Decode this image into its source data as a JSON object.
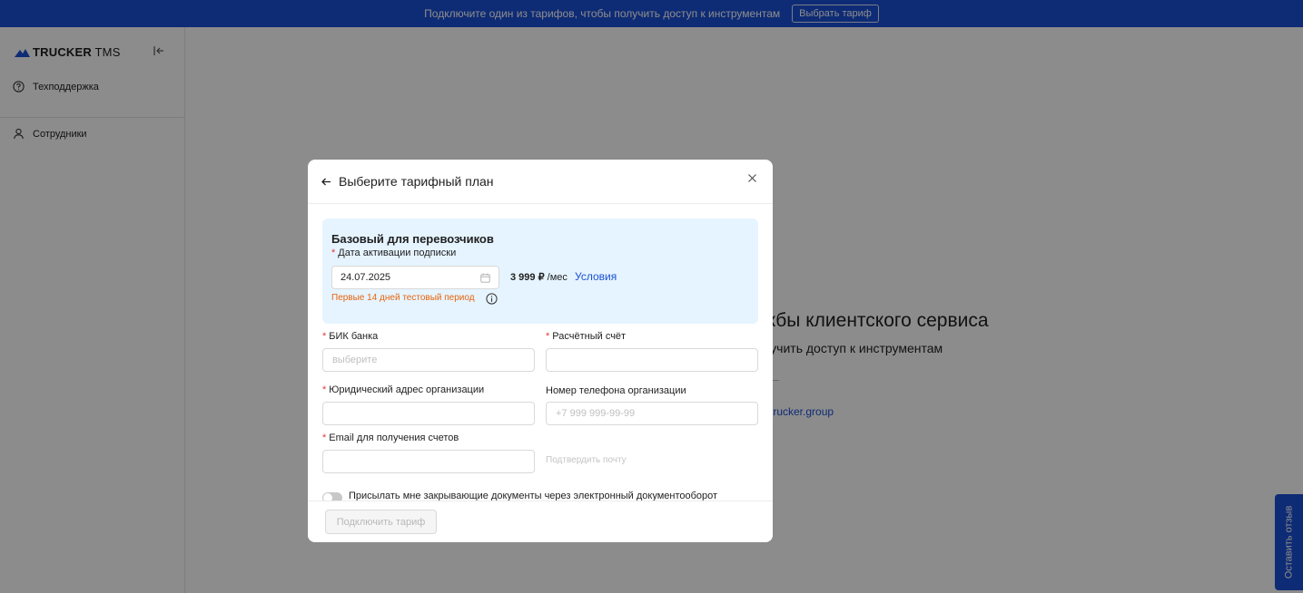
{
  "banner": {
    "text": "Подключите один из тарифов, чтобы получить доступ к инструментам",
    "button_label": "Выбрать тариф",
    "color": "#1a4fd6"
  },
  "sidebar": {
    "logo_bold": "TRUCKER",
    "logo_light": " TMS",
    "items": [
      {
        "label": "Техподдержка",
        "icon": "help-circle-icon"
      },
      {
        "label": "Сотрудники",
        "icon": "user-icon"
      }
    ]
  },
  "background": {
    "title_fragment": "жбы клиентского сервиса",
    "subtitle_fragment": "лучить доступ к инструментам",
    "link_fragment": "trucker.group"
  },
  "feedback": {
    "label": "Оставить отзыв"
  },
  "modal": {
    "title": "Выберите тарифный план",
    "plan": {
      "name": "Базовый для перевозчиков",
      "date_label": "Дата активации подписки",
      "date_value": "24.07.2025",
      "price": "3 999 ₽",
      "price_unit": " /мес",
      "terms_link": "Условия",
      "trial_note": "Первые 14 дней тестовый период"
    },
    "fields": {
      "bik_label": "БИК банка",
      "bik_placeholder": "выберите",
      "account_label": "Расчётный счёт",
      "account_value": "",
      "address_label": "Юридический адрес организации",
      "address_value": "",
      "phone_label": "Номер телефона организации",
      "phone_placeholder": "+7 999 999-99-99",
      "email_label": "Email для получения счетов",
      "email_value": "",
      "confirm_email": "Подтвердить почту"
    },
    "edo_toggle_label": "Присылать мне закрывающие документы через электронный документооборот",
    "edo_toggle_on": false,
    "submit_label": "Подключить тариф"
  },
  "required_mark": "*"
}
